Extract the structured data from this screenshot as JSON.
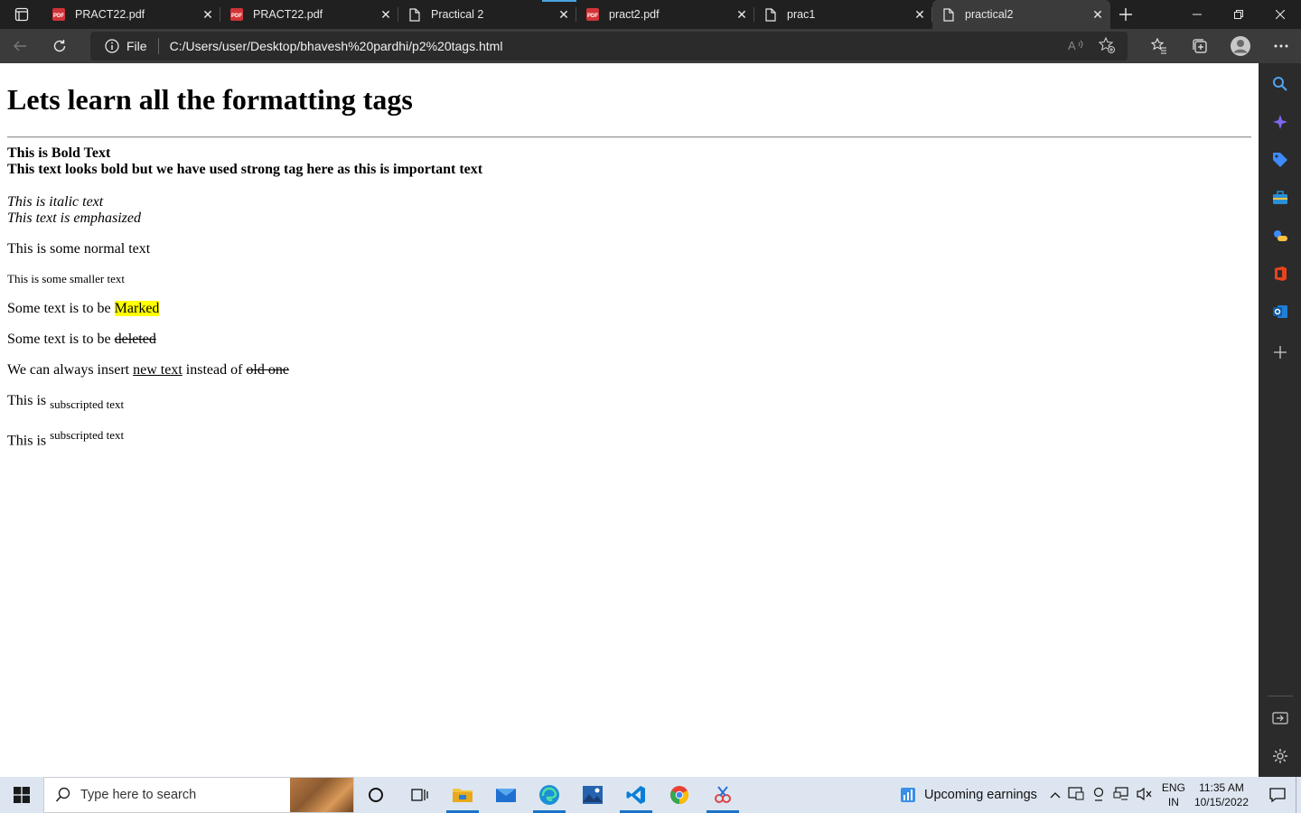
{
  "browser": {
    "tabs": [
      {
        "title": "PRACT22.pdf",
        "icon": "pdf-icon",
        "active": false
      },
      {
        "title": "PRACT22.pdf",
        "icon": "pdf-icon",
        "active": false
      },
      {
        "title": "Practical 2",
        "icon": "page-icon",
        "active": false
      },
      {
        "title": "pract2.pdf",
        "icon": "pdf-icon",
        "active": false
      },
      {
        "title": "prac1",
        "icon": "page-icon",
        "active": false
      },
      {
        "title": "practical2",
        "icon": "page-icon",
        "active": true
      }
    ],
    "site_info_label": "File",
    "url": "C:/Users/user/Desktop/bhavesh%20pardhi/p2%20tags.html"
  },
  "page": {
    "heading": "Lets learn all the formatting tags",
    "bold_text": "This is Bold Text",
    "strong_text": "This text looks bold but we have used strong tag here as this is important text",
    "italic_text": "This is italic text",
    "em_text": "This text is emphasized",
    "normal_text": "This is some normal text",
    "small_text": "This is some smaller text",
    "mark_prefix": "Some text is to be ",
    "mark_text": "Marked",
    "del_prefix": "Some text is to be ",
    "del_text": "deleted",
    "ins_prefix": "We can always insert ",
    "ins_text": "new text",
    "ins_middle": " instead of ",
    "ins_old": "old one",
    "sub_prefix": "This is ",
    "sub_text": "subscripted text",
    "sup_prefix": "This is ",
    "sup_text": "subscripted text"
  },
  "taskbar": {
    "search_placeholder": "Type here to search",
    "weather_label": "Upcoming earnings",
    "lang_line1": "ENG",
    "lang_line2": "IN",
    "time": "11:35 AM",
    "date": "10/15/2022"
  },
  "colors": {
    "mark_highlight": "#ffff00",
    "tabstrip_bg": "#202020",
    "toolbar_bg": "#3b3b3b",
    "taskbar_bg": "#dde6f0"
  }
}
